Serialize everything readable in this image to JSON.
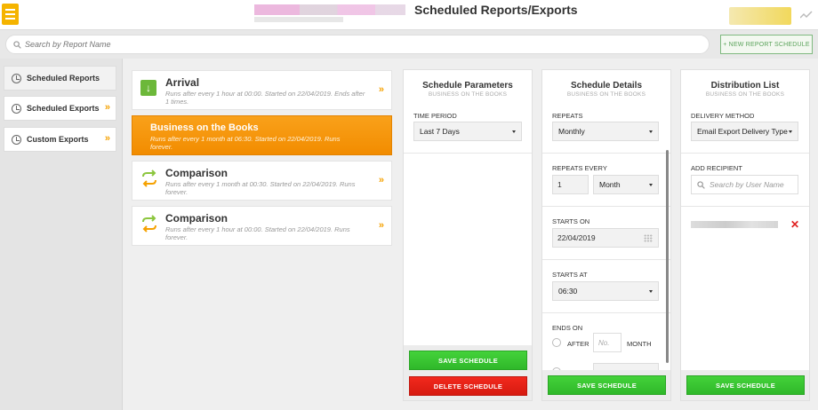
{
  "header": {
    "title": "Scheduled Reports/Exports",
    "menu_icon": "hamburger-menu-icon",
    "stats_icon": "line-chart-icon"
  },
  "search": {
    "placeholder": "Search by Report Name"
  },
  "new_button": {
    "label": "+ NEW REPORT SCHEDULE"
  },
  "sidebar": {
    "items": [
      {
        "label": "Scheduled Reports",
        "active": true
      },
      {
        "label": "Scheduled Exports",
        "active": false
      },
      {
        "label": "Custom Exports",
        "active": false
      }
    ]
  },
  "reports": [
    {
      "title": "Arrival",
      "description": "Runs after every 1 hour at 00:00. Started on 22/04/2019. Ends after 1 times.",
      "icon": "download-arrow-icon",
      "active": false
    },
    {
      "title": "Business on the Books",
      "description": "Runs after every 1 month at 06:30. Started on 22/04/2019. Runs forever.",
      "icon": "",
      "active": true
    },
    {
      "title": "Comparison",
      "description": "Runs after every 1 month at 00:30. Started on 22/04/2019. Runs forever.",
      "icon": "swap-arrows-icon",
      "active": false
    },
    {
      "title": "Comparison",
      "description": "Runs after every 1 hour at 00:00. Started on 22/04/2019. Runs forever.",
      "icon": "swap-arrows-icon",
      "active": false
    }
  ],
  "schedule_parameters": {
    "title": "Schedule Parameters",
    "subtitle": "BUSINESS ON THE BOOKS",
    "time_period_label": "TIME PERIOD",
    "time_period_value": "Last 7 Days",
    "save_label": "SAVE SCHEDULE",
    "delete_label": "DELETE SCHEDULE"
  },
  "schedule_details": {
    "title": "Schedule Details",
    "subtitle": "BUSINESS ON THE BOOKS",
    "repeats_label": "REPEATS",
    "repeats_value": "Monthly",
    "repeats_every_label": "REPEATS EVERY",
    "repeats_every_count": "1",
    "repeats_every_unit": "Month",
    "starts_on_label": "STARTS ON",
    "starts_on_value": "22/04/2019",
    "starts_at_label": "STARTS AT",
    "starts_at_value": "06:30",
    "ends_on_label": "ENDS ON",
    "after_label": "AFTER",
    "no_placeholder": "No.",
    "month_label": "MONTH",
    "save_label": "SAVE SCHEDULE"
  },
  "distribution_list": {
    "title": "Distribution List",
    "subtitle": "BUSINESS ON THE BOOKS",
    "delivery_method_label": "DELIVERY METHOD",
    "delivery_method_value": "Email Export Delivery Type",
    "add_recipient_label": "ADD RECIPIENT",
    "search_placeholder": "Search by User Name",
    "save_label": "SAVE SCHEDULE"
  },
  "colors": {
    "accent": "#f5a100",
    "green": "#3cc634",
    "red": "#e0211a"
  }
}
